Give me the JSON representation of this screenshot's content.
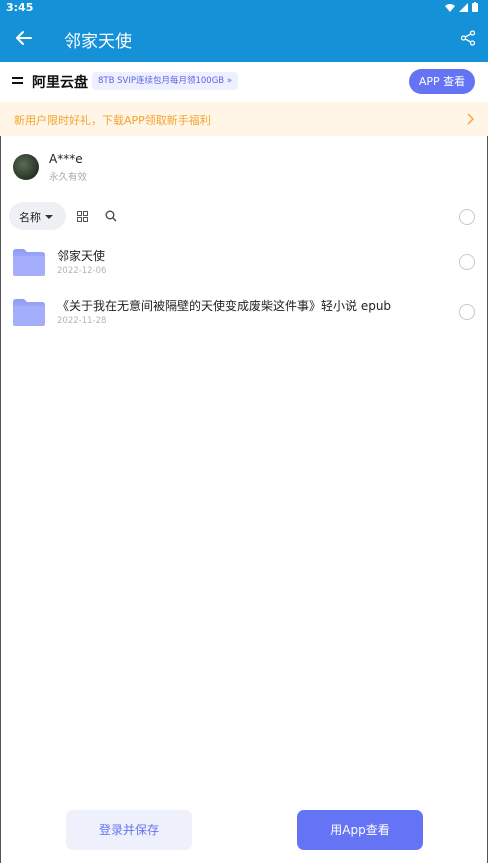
{
  "status_bar": {
    "time": "3:45"
  },
  "app_bar": {
    "title": "邻家天使"
  },
  "brand_bar": {
    "brand": "阿里云盘",
    "promo": "8TB SVIP连续包月每月领100GB »",
    "app_button": "APP 查看"
  },
  "banner": {
    "text": "新用户限时好礼，下载APP领取新手福利"
  },
  "owner": {
    "name": "A***e",
    "validity": "永久有效"
  },
  "toolbar": {
    "sort_label": "名称"
  },
  "files": [
    {
      "name": "邻家天使",
      "date": "2022-12-06"
    },
    {
      "name": "《关于我在无意间被隔壁的天使变成废柴这件事》轻小说 epub",
      "date": "2022-11-28"
    }
  ],
  "bottom": {
    "save_label": "登录并保存",
    "app_label": "用App查看"
  },
  "colors": {
    "accent": "#6574f4",
    "header": "#1591d8",
    "banner_text": "#f6a32e"
  }
}
